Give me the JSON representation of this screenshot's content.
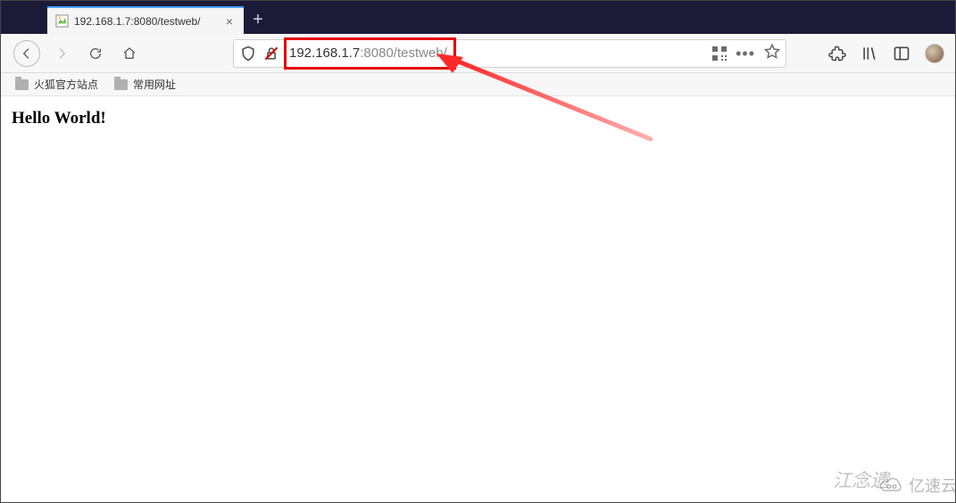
{
  "tab": {
    "title": "192.168.1.7:8080/testweb/"
  },
  "url": {
    "host": "192.168.1.7",
    "port_path": ":8080/testweb/"
  },
  "bookmarks": {
    "item1": "火狐官方站点",
    "item2": "常用网址"
  },
  "page": {
    "heading": "Hello World!"
  },
  "watermark": {
    "text1": "江念遗",
    "text2": "亿速云"
  }
}
